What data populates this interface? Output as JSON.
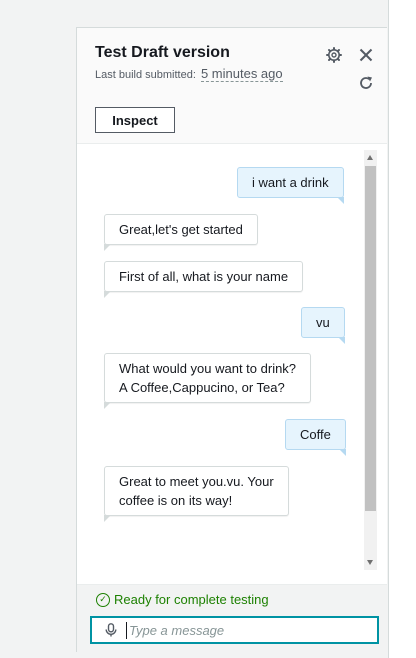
{
  "panel": {
    "title": "Test Draft version",
    "subtitle_prefix": "Last build submitted:",
    "subtitle_time": "5 minutes ago",
    "inspect_label": "Inspect"
  },
  "messages": [
    {
      "role": "user",
      "text": "i want a drink"
    },
    {
      "role": "bot",
      "text": "Great,let's get started"
    },
    {
      "role": "bot",
      "text": "First of all, what is your name"
    },
    {
      "role": "user",
      "text": "vu"
    },
    {
      "role": "bot",
      "line1": "What would you want to drink?",
      "line2": "A Coffee,Cappucino, or Tea?"
    },
    {
      "role": "user",
      "text": "Coffe"
    },
    {
      "role": "bot",
      "line1": "Great to meet you.vu. Your",
      "line2": "coffee is on its way!"
    }
  ],
  "footer": {
    "status": "Ready for complete testing",
    "input_placeholder": "Type a message",
    "input_value": ""
  },
  "colors": {
    "status_green": "#1d8102",
    "input_border": "#0093a3",
    "user_bubble": "#e6f4fd"
  },
  "icons": {
    "settings": "gear-icon",
    "close": "close-icon",
    "refresh": "refresh-icon",
    "status": "check-circle-icon",
    "mic": "microphone-icon"
  }
}
